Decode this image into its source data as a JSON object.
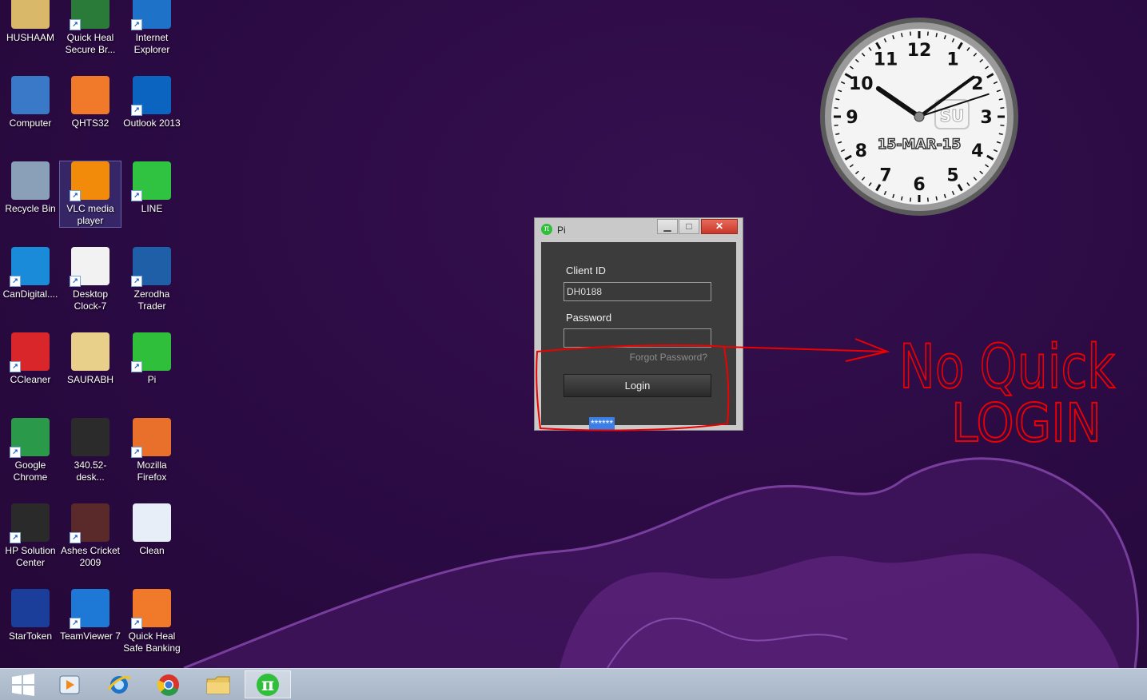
{
  "desktop": {
    "icons": [
      {
        "label": "HUSHAAM",
        "icon": "user-folder-icon",
        "color": "#d9b86a",
        "shortcut": false
      },
      {
        "label": "Quick Heal Secure Br...",
        "icon": "globe-shield-icon",
        "color": "#2a7a3a",
        "shortcut": true
      },
      {
        "label": "Internet Explorer",
        "icon": "internet-explorer-icon",
        "color": "#1e73c8",
        "shortcut": true
      },
      {
        "label": "Computer",
        "icon": "computer-icon",
        "color": "#3a78c8",
        "shortcut": false
      },
      {
        "label": "QHTS32",
        "icon": "qhts-icon",
        "color": "#f07a2a",
        "shortcut": false
      },
      {
        "label": "Outlook 2013",
        "icon": "outlook-icon",
        "color": "#0b64c0",
        "shortcut": true
      },
      {
        "label": "Recycle Bin",
        "icon": "recycle-bin-icon",
        "color": "#8aa0b8",
        "shortcut": false
      },
      {
        "label": "VLC media player",
        "icon": "vlc-icon",
        "color": "#f28a0a",
        "shortcut": true
      },
      {
        "label": "LINE",
        "icon": "line-app-icon",
        "color": "#2fc341",
        "shortcut": true
      },
      {
        "label": "CanDigital....",
        "icon": "candigital-icon",
        "color": "#1a8bd8",
        "shortcut": true
      },
      {
        "label": "Desktop Clock-7",
        "icon": "desktop-clock-icon",
        "color": "#f2f2f2",
        "shortcut": true
      },
      {
        "label": "Zerodha Trader",
        "icon": "zerodha-icon",
        "color": "#1e5fa8",
        "shortcut": true
      },
      {
        "label": "CCleaner",
        "icon": "ccleaner-icon",
        "color": "#d8262a",
        "shortcut": true
      },
      {
        "label": "SAURABH",
        "icon": "folder-icon",
        "color": "#e8d08a",
        "shortcut": false
      },
      {
        "label": "Pi",
        "icon": "pi-icon",
        "color": "#2fbf3a",
        "shortcut": true
      },
      {
        "label": "Google Chrome",
        "icon": "chrome-icon",
        "color": "#2a9a4a",
        "shortcut": true
      },
      {
        "label": "340.52-desk...",
        "icon": "nvidia-icon",
        "color": "#2b2b2b",
        "shortcut": false
      },
      {
        "label": "Mozilla Firefox",
        "icon": "firefox-icon",
        "color": "#e8702a",
        "shortcut": true
      },
      {
        "label": "HP Solution Center",
        "icon": "hp-icon",
        "color": "#2a2a2a",
        "shortcut": true
      },
      {
        "label": "Ashes Cricket 2009",
        "icon": "ashes-cricket-icon",
        "color": "#5a2a2a",
        "shortcut": true
      },
      {
        "label": "Clean",
        "icon": "clean-gear-icon",
        "color": "#e8eef8",
        "shortcut": false
      },
      {
        "label": "StarToken",
        "icon": "startoken-icon",
        "color": "#1a3e9a",
        "shortcut": false
      },
      {
        "label": "TeamViewer 7",
        "icon": "teamviewer-icon",
        "color": "#1e78d6",
        "shortcut": true
      },
      {
        "label": "Quick Heal Safe Banking",
        "icon": "safe-banking-icon",
        "color": "#f07a2a",
        "shortcut": true
      }
    ]
  },
  "pi_window": {
    "title": "Pi",
    "title_icon_glyph": "π",
    "min_glyph": "▁",
    "max_glyph": "□",
    "close_glyph": "✕",
    "client_id_label": "Client ID",
    "client_id_value": "DH0188",
    "password_label": "Password",
    "password_value": "******",
    "forgot_password": "Forgot Password?",
    "login_button": "Login"
  },
  "clock": {
    "numbers": [
      "12",
      "1",
      "2",
      "3",
      "4",
      "5",
      "6",
      "7",
      "8",
      "9",
      "10",
      "11"
    ],
    "date_text": "15-MAR-15",
    "badge_text": "SU",
    "hour_hand": {
      "hour": 10,
      "minute": 9
    },
    "second_hand_seconds": 12
  },
  "annotation": {
    "line1": "No Quick",
    "line2": "LOGIN",
    "color": "#e00000"
  },
  "taskbar": {
    "items": [
      {
        "name": "start-button",
        "icon": "windows-logo-icon"
      },
      {
        "name": "media-player-button",
        "icon": "media-player-icon"
      },
      {
        "name": "internet-explorer-button",
        "icon": "internet-explorer-icon"
      },
      {
        "name": "chrome-button",
        "icon": "chrome-icon"
      },
      {
        "name": "file-explorer-button",
        "icon": "folder-icon"
      },
      {
        "name": "pi-taskbar-button",
        "icon": "pi-icon",
        "active": true
      }
    ]
  }
}
